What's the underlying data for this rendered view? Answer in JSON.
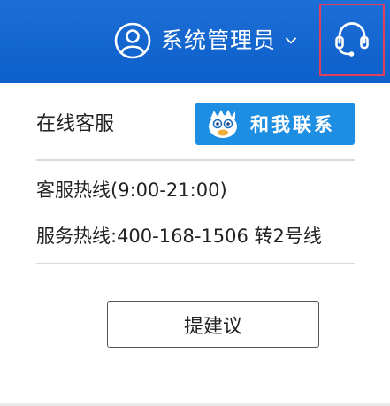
{
  "header": {
    "user_name": "系统管理员",
    "user_icon": "user-circle-icon",
    "dropdown_icon": "chevron-down-icon",
    "support_icon": "headset-icon"
  },
  "panel": {
    "online_service_label": "在线客服",
    "contact_button_label": "和我联系",
    "hotline_text": "客服热线(9:00-21:00)",
    "service_line_text": "服务热线:400-168-1506 转2号线",
    "suggest_button_label": "提建议"
  },
  "colors": {
    "header_blue": "#0d5fc9",
    "contact_button_blue": "#1e8ee3",
    "highlight_border": "#e0405a"
  }
}
